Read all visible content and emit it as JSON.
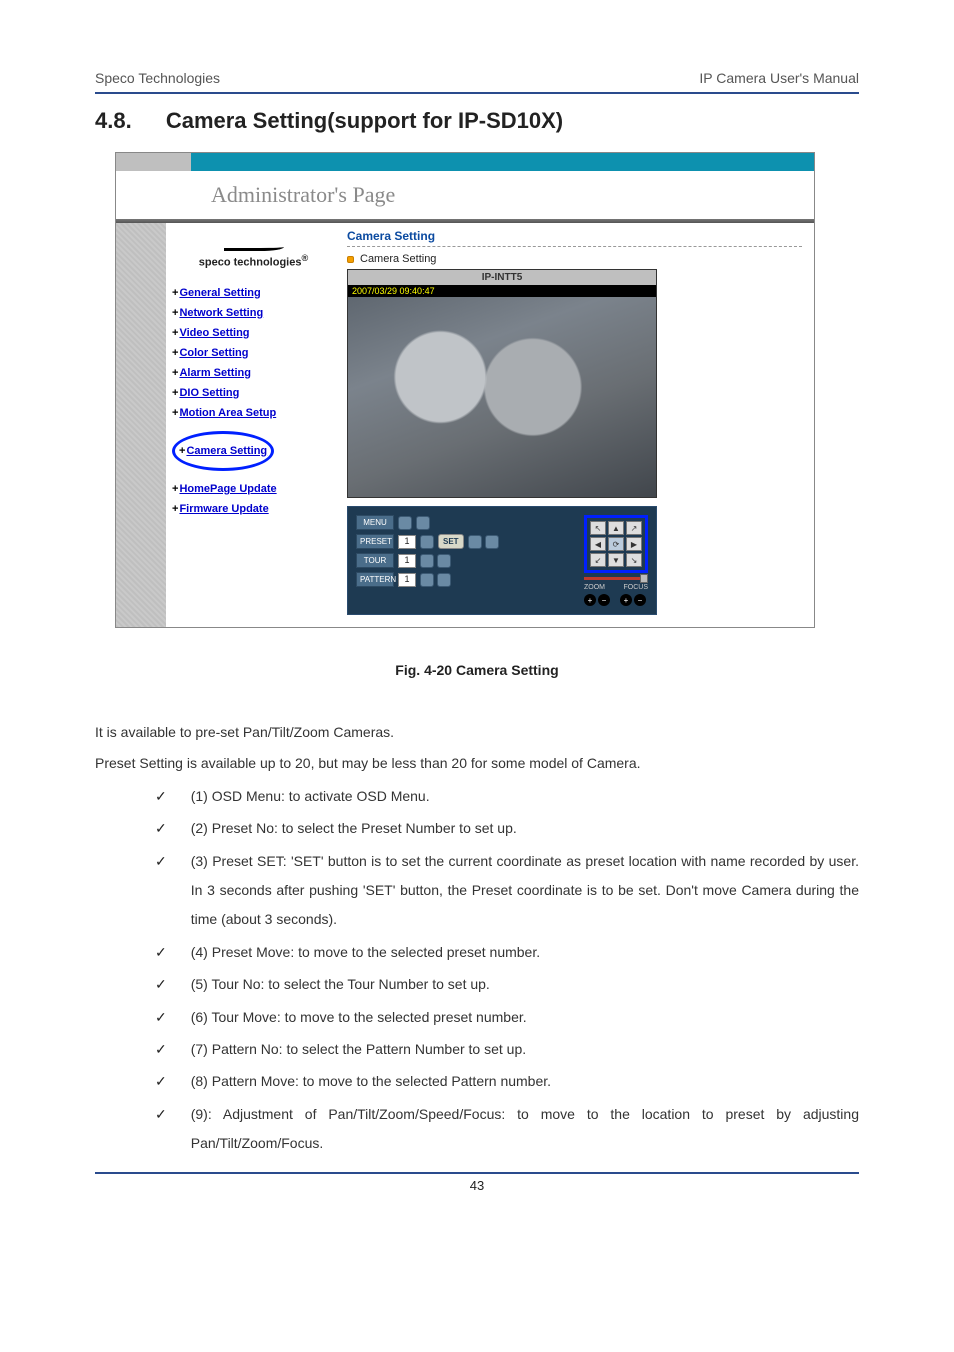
{
  "header": {
    "left": "Speco Technologies",
    "right": "IP Camera User's Manual"
  },
  "section": {
    "number": "4.8.",
    "title": "Camera Setting(support for IP-SD10X)"
  },
  "screenshot": {
    "admin_title": "Administrator's  Page",
    "logo": "speco technologies",
    "panel_title": "Camera Setting",
    "panel_sub": "Camera Setting",
    "video_caption": "IP-INTT5",
    "video_ts": "2007/03/29 09:40:47",
    "nav": [
      "General Setting",
      "Network Setting",
      "Video Setting",
      "Color Setting",
      "Alarm Setting",
      "DIO Setting",
      "Motion Area Setup",
      "Camera Setting",
      "HomePage Update",
      "Firmware Update"
    ],
    "nav_highlight_index": 7,
    "controls": {
      "menu": "MENU",
      "preset": "PRESET",
      "tour": "TOUR",
      "pattern": "PATTERN",
      "set": "SET",
      "preset_val": "1",
      "tour_val": "1",
      "pattern_val": "1",
      "zoom": "ZOOM",
      "focus": "FOCUS"
    }
  },
  "figure_caption": "Fig.   4-20 Camera Setting",
  "paragraphs": [
    "It is available to pre-set Pan/Tilt/Zoom Cameras.",
    "Preset Setting is available up to 20, but may be less than 20 for some model of Camera."
  ],
  "items": [
    "(1) OSD Menu: to activate OSD Menu.",
    "(2) Preset No: to select the Preset Number to set up.",
    "(3) Preset SET:  'SET' button is to set the current coordinate as preset location with name recorded by user.   In 3 seconds after pushing 'SET' button, the Preset coordinate is to be set. Don't move Camera during the time (about 3 seconds).",
    "(4) Preset Move: to move to the selected preset number.",
    "(5) Tour No: to select the Tour Number to set up.",
    "(6) Tour Move: to move to the selected preset number.",
    "(7) Pattern No: to select the Pattern Number to set up.",
    "(8) Pattern Move: to move to the selected Pattern number.",
    "(9): Adjustment of Pan/Tilt/Zoom/Speed/Focus: to move to the location to preset by adjusting Pan/Tilt/Zoom/Focus."
  ],
  "page_number": "43"
}
